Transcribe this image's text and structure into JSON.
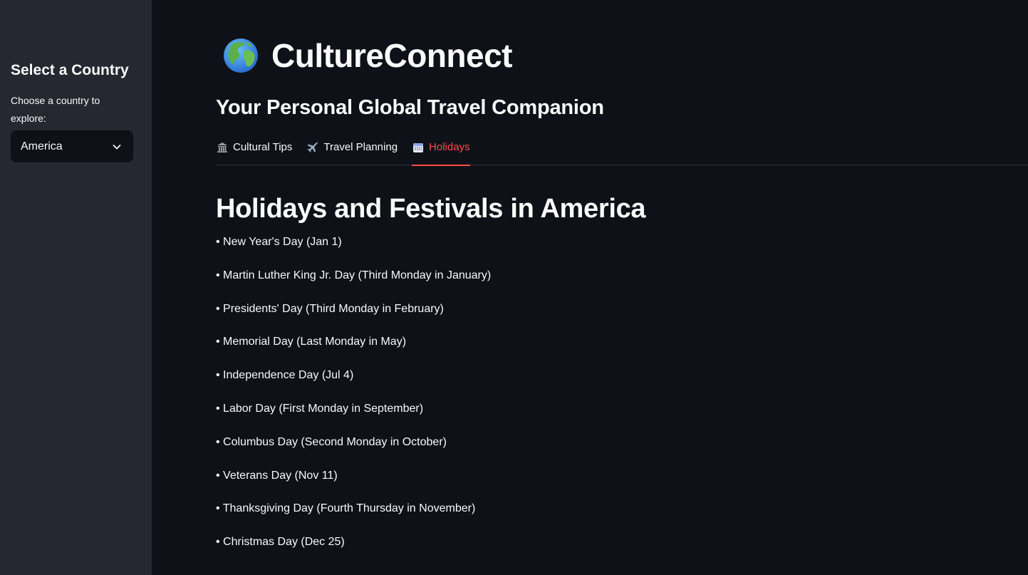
{
  "sidebar": {
    "title": "Select a Country",
    "select_label": "Choose a country to explore:",
    "selected_country": "America"
  },
  "header": {
    "globe_icon": "globe-europe-africa-icon",
    "title": "CultureConnect",
    "subtitle": "Your Personal Global Travel Companion"
  },
  "tabs": [
    {
      "label": "Cultural Tips",
      "icon": "classical-building-icon",
      "active": false
    },
    {
      "label": "Travel Planning",
      "icon": "airplane-icon",
      "active": false
    },
    {
      "label": "Holidays",
      "icon": "calendar-icon",
      "active": true
    }
  ],
  "main": {
    "heading": "Holidays and Festivals in America",
    "holidays": [
      "• New Year's Day (Jan 1)",
      "• Martin Luther King Jr. Day (Third Monday in January)",
      "• Presidents' Day (Third Monday in February)",
      "• Memorial Day (Last Monday in May)",
      "• Independence Day (Jul 4)",
      "• Labor Day (First Monday in September)",
      "• Columbus Day (Second Monday in October)",
      "• Veterans Day (Nov 11)",
      "• Thanksgiving Day (Fourth Thursday in November)",
      "• Christmas Day (Dec 25)"
    ]
  },
  "colors": {
    "background": "#0e1117",
    "sidebar": "#262730",
    "accent": "#ff4b4b",
    "text": "#fafafa"
  }
}
